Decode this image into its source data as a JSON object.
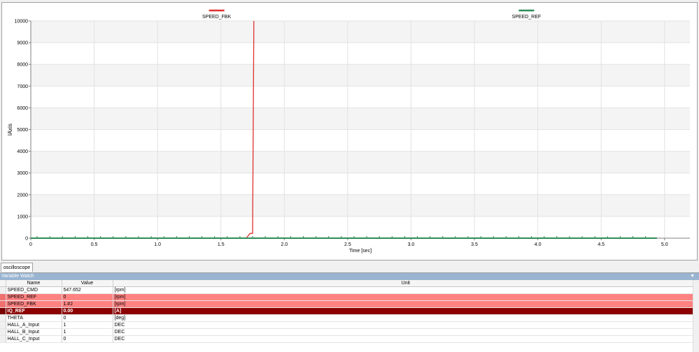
{
  "chart_data": {
    "type": "line",
    "xlabel": "Time [sec]",
    "ylabel": "lAxis",
    "xlim": [
      0,
      5.2
    ],
    "ylim": [
      0,
      10000
    ],
    "x_ticks": [
      "0",
      "0.5",
      "1.0",
      "1.5",
      "2.0",
      "2.5",
      "3.0",
      "3.5",
      "4.0",
      "4.5",
      "5.0"
    ],
    "y_ticks": [
      "0",
      "1000",
      "2000",
      "3000",
      "4000",
      "5000",
      "6000",
      "7000",
      "8000",
      "9000",
      "10000"
    ],
    "grid": true,
    "legend_position": "top",
    "series": [
      {
        "name": "SPEED_FBK",
        "color": "#e03030",
        "points": [
          [
            0,
            0
          ],
          [
            1.7,
            0
          ],
          [
            1.73,
            220
          ],
          [
            1.75,
            220
          ],
          [
            1.76,
            10000
          ]
        ]
      },
      {
        "name": "SPEED_REF",
        "color": "#2e8b57",
        "points": [
          [
            0,
            0
          ],
          [
            4.94,
            0
          ]
        ]
      }
    ]
  },
  "tabs": [
    {
      "label": "oscilloscope"
    }
  ],
  "watch": {
    "title": "Variable Watch",
    "columns": {
      "name": "Name",
      "value": "Value",
      "unit": "Unit"
    },
    "rows": [
      {
        "name": "SPEED_CMD",
        "value": "547.652",
        "unit": "[rpm]",
        "state": "normal"
      },
      {
        "name": "SPEED_REF",
        "value": "0",
        "unit": "[rpm]",
        "state": "hl"
      },
      {
        "name": "SPEED_FBK",
        "value": "1.#J",
        "unit": "[rpm]",
        "state": "hl"
      },
      {
        "name": "IQ_REF",
        "value": "0.00",
        "unit": "[A]",
        "state": "dark"
      },
      {
        "name": "THETA",
        "value": "0",
        "unit": "[deg]",
        "state": "normal"
      },
      {
        "name": "HALL_A_Input",
        "value": "1",
        "unit": "DEC",
        "state": "normal"
      },
      {
        "name": "HALL_B_Input",
        "value": "1",
        "unit": "DEC",
        "state": "normal"
      },
      {
        "name": "HALL_C_Input",
        "value": "0",
        "unit": "DEC",
        "state": "normal"
      }
    ]
  }
}
